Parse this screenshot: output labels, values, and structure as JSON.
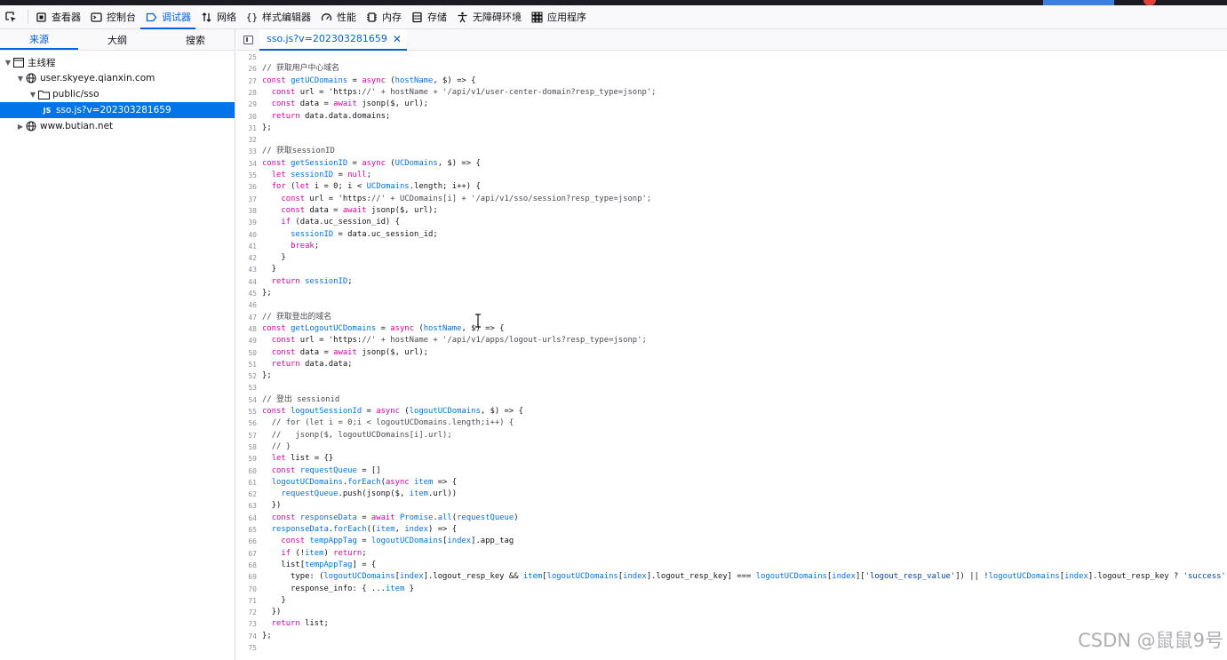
{
  "toolbar": {
    "items": [
      {
        "label": "查看器",
        "icon": "inspector-icon"
      },
      {
        "label": "控制台",
        "icon": "console-icon"
      },
      {
        "label": "调试器",
        "icon": "debugger-icon"
      },
      {
        "label": "网络",
        "icon": "network-icon"
      },
      {
        "label": "样式编辑器",
        "icon": "style-editor-icon"
      },
      {
        "label": "性能",
        "icon": "performance-icon"
      },
      {
        "label": "内存",
        "icon": "memory-icon"
      },
      {
        "label": "存储",
        "icon": "storage-icon"
      },
      {
        "label": "无障碍环境",
        "icon": "accessibility-icon"
      },
      {
        "label": "应用程序",
        "icon": "application-icon"
      }
    ],
    "active": "调试器"
  },
  "left_tabs": {
    "sources": "来源",
    "outline": "大纲",
    "search": "搜索"
  },
  "tree": {
    "main_thread": "主线程",
    "domain1": "user.skyeye.qianxin.com",
    "folder": "public/sso",
    "file": "sso.js?v=202303281659",
    "domain2": "www.butian.net"
  },
  "editor_tab": {
    "label": "sso.js?v=202303281659"
  },
  "code_lines": [
    {
      "n": "25",
      "t": ""
    },
    {
      "n": "26",
      "t": "// 获取用户中心域名"
    },
    {
      "n": "27",
      "t": "const getUCDomains = async (hostName, $) => {"
    },
    {
      "n": "28",
      "t": "  const url = 'https://' + hostName + '/api/v1/user-center-domain?resp_type=jsonp';"
    },
    {
      "n": "29",
      "t": "  const data = await jsonp($, url);"
    },
    {
      "n": "30",
      "t": "  return data.data.domains;"
    },
    {
      "n": "31",
      "t": "};"
    },
    {
      "n": "32",
      "t": ""
    },
    {
      "n": "33",
      "t": "// 获取sessionID"
    },
    {
      "n": "34",
      "t": "const getSessionID = async (UCDomains, $) => {"
    },
    {
      "n": "35",
      "t": "  let sessionID = null;"
    },
    {
      "n": "36",
      "t": "  for (let i = 0; i < UCDomains.length; i++) {"
    },
    {
      "n": "37",
      "t": "    const url = 'https://' + UCDomains[i] + '/api/v1/sso/session?resp_type=jsonp';"
    },
    {
      "n": "38",
      "t": "    const data = await jsonp($, url);"
    },
    {
      "n": "39",
      "t": "    if (data.uc_session_id) {"
    },
    {
      "n": "40",
      "t": "      sessionID = data.uc_session_id;"
    },
    {
      "n": "41",
      "t": "      break;"
    },
    {
      "n": "42",
      "t": "    }"
    },
    {
      "n": "43",
      "t": "  }"
    },
    {
      "n": "44",
      "t": "  return sessionID;"
    },
    {
      "n": "45",
      "t": "};"
    },
    {
      "n": "46",
      "t": ""
    },
    {
      "n": "47",
      "t": "// 获取登出的域名"
    },
    {
      "n": "48",
      "t": "const getLogoutUCDomains = async (hostName, $) => {"
    },
    {
      "n": "49",
      "t": "  const url = 'https://' + hostName + '/api/v1/apps/logout-urls?resp_type=jsonp';"
    },
    {
      "n": "50",
      "t": "  const data = await jsonp($, url);"
    },
    {
      "n": "51",
      "t": "  return data.data;"
    },
    {
      "n": "52",
      "t": "};"
    },
    {
      "n": "53",
      "t": ""
    },
    {
      "n": "54",
      "t": "// 登出 sessionid"
    },
    {
      "n": "55",
      "t": "const logoutSessionId = async (logoutUCDomains, $) => {"
    },
    {
      "n": "56",
      "t": "  // for (let i = 0;i < logoutUCDomains.length;i++) {"
    },
    {
      "n": "57",
      "t": "  //   jsonp($, logoutUCDomains[i].url);"
    },
    {
      "n": "58",
      "t": "  // }"
    },
    {
      "n": "59",
      "t": "  let list = {}"
    },
    {
      "n": "60",
      "t": "  const requestQueue = []"
    },
    {
      "n": "61",
      "t": "  logoutUCDomains.forEach(async item => {"
    },
    {
      "n": "62",
      "t": "    requestQueue.push(jsonp($, item.url))"
    },
    {
      "n": "63",
      "t": "  })"
    },
    {
      "n": "64",
      "t": "  const responseData = await Promise.all(requestQueue)"
    },
    {
      "n": "65",
      "t": "  responseData.forEach((item, index) => {"
    },
    {
      "n": "66",
      "t": "    const tempAppTag = logoutUCDomains[index].app_tag"
    },
    {
      "n": "67",
      "t": "    if (!item) return;"
    },
    {
      "n": "68",
      "t": "    list[tempAppTag] = {"
    },
    {
      "n": "69",
      "t": "      type: (logoutUCDomains[index].logout_resp_key && item[logoutUCDomains[index].logout_resp_key] === logoutUCDomains[index]['logout_resp_value']) || !logoutUCDomains[index].logout_resp_key ? 'success' :"
    },
    {
      "n": "70",
      "t": "      response_info: { ...item }"
    },
    {
      "n": "71",
      "t": "    }"
    },
    {
      "n": "72",
      "t": "  })"
    },
    {
      "n": "73",
      "t": "  return list;"
    },
    {
      "n": "74",
      "t": "};"
    },
    {
      "n": "75",
      "t": ""
    }
  ],
  "watermark": "CSDN @鼠鼠9号",
  "colors": {
    "accent": "#0061e0",
    "selected": "#0074e8",
    "keyword": "#dd00a9"
  }
}
